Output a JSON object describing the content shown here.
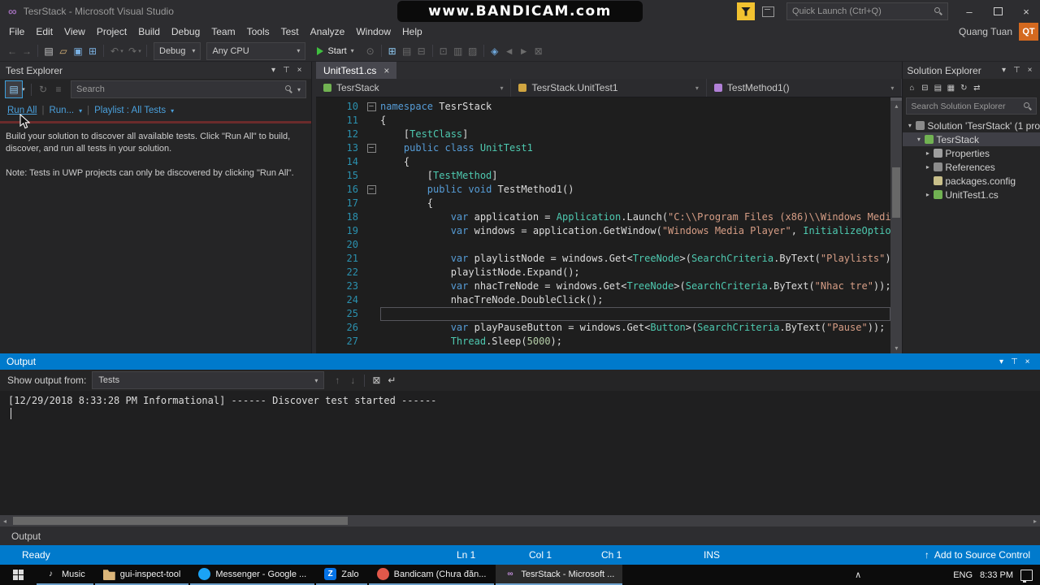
{
  "glyphs": {
    "chevron_down": "▾",
    "chevron_right": "▸",
    "triangle_up": "▴",
    "triangle_down": "▾",
    "triangle_left": "◂",
    "triangle_right": "▸",
    "close": "×",
    "pin": "⊤",
    "minimize": "–",
    "fold_collapse": "–",
    "infinity": "∞",
    "separator_bar": "|",
    "up_arrow": "↑"
  },
  "colors": {
    "accent_blue": "#007acc",
    "chrome_background": "#2d2d30",
    "panel_background": "#252526",
    "editor_background": "#1e1e1e",
    "keyword": "#569cd6",
    "type": "#4ec9b0",
    "string": "#d69d85",
    "number": "#b5cea8",
    "line_number": "#2b91af",
    "link_blue": "#4aa0dc",
    "bandicam_red": "#e23c32"
  },
  "window": {
    "title": "TesrStack - Microsoft Visual Studio",
    "watermark": "www.BANDICAM.com",
    "quick_launch_placeholder": "Quick Launch (Ctrl+Q)",
    "user_name": "Quang Tuan",
    "user_initials": "QT"
  },
  "menu": {
    "items": [
      "File",
      "Edit",
      "View",
      "Project",
      "Build",
      "Debug",
      "Team",
      "Tools",
      "Test",
      "Analyze",
      "Window",
      "Help"
    ]
  },
  "toolbar": {
    "config_value": "Debug",
    "platform_value": "Any CPU",
    "start_label": "Start",
    "icons_left": [
      {
        "name": "navigate-backward",
        "glyph": "←",
        "cls": "dim"
      },
      {
        "name": "navigate-forward",
        "glyph": "→",
        "cls": "dim"
      },
      {
        "name": "separator",
        "cls": "sep",
        "ni": true
      },
      {
        "name": "new-project",
        "glyph": "▤"
      },
      {
        "name": "open-file",
        "glyph": "▱",
        "color": "#dcb67a"
      },
      {
        "name": "save",
        "glyph": "▣",
        "color": "#7ab0e2"
      },
      {
        "name": "save-all",
        "glyph": "⊞",
        "color": "#7ab0e2"
      },
      {
        "name": "separator",
        "cls": "sep",
        "ni": true
      },
      {
        "name": "undo",
        "glyph": "↶",
        "cls": "dim"
      },
      {
        "name": "undo-dropdown",
        "glyph": "▾",
        "cls": "dim chev-sm"
      },
      {
        "name": "redo",
        "glyph": "↷",
        "cls": "dim"
      },
      {
        "name": "redo-dropdown",
        "glyph": "▾",
        "cls": "dim chev-sm"
      },
      {
        "name": "separator",
        "cls": "sep",
        "ni": true
      }
    ],
    "icons_right": [
      {
        "name": "hot-reload",
        "glyph": "⊙",
        "cls": "dim"
      },
      {
        "name": "separator",
        "cls": "sep",
        "ni": true
      },
      {
        "name": "solution-explorer-shortcut",
        "glyph": "⊞",
        "color": "#8fc9f2"
      },
      {
        "name": "properties-window",
        "glyph": "▤",
        "cls": "dim"
      },
      {
        "name": "toolbox",
        "glyph": "⊟",
        "cls": "dim"
      },
      {
        "name": "separator",
        "cls": "sep",
        "ni": true
      },
      {
        "name": "find-in-files",
        "glyph": "⊡",
        "cls": "dim"
      },
      {
        "name": "comment-out",
        "glyph": "▥",
        "cls": "dim"
      },
      {
        "name": "uncomment-lines",
        "glyph": "▨",
        "cls": "dim"
      },
      {
        "name": "separator",
        "cls": "sep",
        "ni": true
      },
      {
        "name": "toggle-bookmark",
        "glyph": "◈",
        "color": "#6fa8dc"
      },
      {
        "name": "prev-bookmark",
        "glyph": "◄",
        "cls": "dim"
      },
      {
        "name": "next-bookmark",
        "glyph": "►",
        "cls": "dim"
      },
      {
        "name": "clear-bookmarks",
        "glyph": "⊠",
        "cls": "dim"
      }
    ]
  },
  "test_explorer": {
    "title": "Test Explorer",
    "header_icons": [
      {
        "name": "window-menu",
        "glyph": "▾"
      },
      {
        "name": "pin",
        "glyph": "⊤"
      },
      {
        "name": "close",
        "glyph": "×"
      }
    ],
    "toolbar_icons": [
      {
        "name": "group-by",
        "glyph": "▤",
        "cls": "boxed"
      },
      {
        "name": "group-by-dropdown",
        "glyph": "▾",
        "cls": "chev-sm"
      },
      {
        "name": "separator",
        "cls": "sep",
        "ni": true
      },
      {
        "name": "run-after-build",
        "glyph": "↻",
        "cls": "dim"
      },
      {
        "name": "test-hierarchy",
        "glyph": "≡",
        "cls": "dim"
      }
    ],
    "search_placeholder": "Search",
    "run_all_label": "Run All",
    "run_label": "Run...",
    "playlist_label": "Playlist : All Tests",
    "message_primary": "Build your solution to discover all available tests. Click \"Run All\" to build, discover, and run all tests in your solution.",
    "message_note": "Note: Tests in UWP projects can only be discovered by clicking \"Run All\"."
  },
  "editor": {
    "tab_label": "UnitTest1.cs",
    "breadcrumb": {
      "project": "TesrStack",
      "type": "TesrStack.UnitTest1",
      "member": "TestMethod1()"
    },
    "lines": [
      {
        "num": 10,
        "fold": true,
        "tokens": [
          [
            "kw",
            "namespace"
          ],
          [
            "pl",
            " TesrStack"
          ]
        ]
      },
      {
        "num": 11,
        "tokens": [
          [
            "pl",
            "{"
          ]
        ]
      },
      {
        "num": 12,
        "tokens": [
          [
            "pl",
            "    ["
          ],
          [
            "ty",
            "TestClass"
          ],
          [
            "pl",
            "]"
          ]
        ]
      },
      {
        "num": 13,
        "fold": true,
        "tokens": [
          [
            "pl",
            "    "
          ],
          [
            "kw",
            "public"
          ],
          [
            "pl",
            " "
          ],
          [
            "kw",
            "class"
          ],
          [
            "pl",
            " "
          ],
          [
            "ty",
            "UnitTest1"
          ]
        ]
      },
      {
        "num": 14,
        "tokens": [
          [
            "pl",
            "    {"
          ]
        ]
      },
      {
        "num": 15,
        "tokens": [
          [
            "pl",
            "        ["
          ],
          [
            "ty",
            "TestMethod"
          ],
          [
            "pl",
            "]"
          ]
        ]
      },
      {
        "num": 16,
        "fold": true,
        "tokens": [
          [
            "pl",
            "        "
          ],
          [
            "kw",
            "public"
          ],
          [
            "pl",
            " "
          ],
          [
            "kw",
            "void"
          ],
          [
            "pl",
            " TestMethod1()"
          ]
        ]
      },
      {
        "num": 17,
        "tokens": [
          [
            "pl",
            "        {"
          ]
        ]
      },
      {
        "num": 18,
        "tokens": [
          [
            "pl",
            "            "
          ],
          [
            "kw",
            "var"
          ],
          [
            "pl",
            " application = "
          ],
          [
            "ty",
            "Application"
          ],
          [
            "pl",
            ".Launch("
          ],
          [
            "st",
            "\"C:\\\\Program Files (x86)\\\\Windows Medi"
          ]
        ]
      },
      {
        "num": 19,
        "tokens": [
          [
            "pl",
            "            "
          ],
          [
            "kw",
            "var"
          ],
          [
            "pl",
            " windows = application.GetWindow("
          ],
          [
            "st",
            "\"Windows Media Player\""
          ],
          [
            "pl",
            ", "
          ],
          [
            "ty",
            "InitializeOptio"
          ]
        ]
      },
      {
        "num": 20,
        "tokens": []
      },
      {
        "num": 21,
        "tokens": [
          [
            "pl",
            "            "
          ],
          [
            "kw",
            "var"
          ],
          [
            "pl",
            " playlistNode = windows.Get<"
          ],
          [
            "ty",
            "TreeNode"
          ],
          [
            "pl",
            ">("
          ],
          [
            "ty",
            "SearchCriteria"
          ],
          [
            "pl",
            ".ByText("
          ],
          [
            "st",
            "\"Playlists\""
          ],
          [
            "pl",
            ")"
          ]
        ]
      },
      {
        "num": 22,
        "tokens": [
          [
            "pl",
            "            playlistNode.Expand();"
          ]
        ]
      },
      {
        "num": 23,
        "tokens": [
          [
            "pl",
            "            "
          ],
          [
            "kw",
            "var"
          ],
          [
            "pl",
            " nhacTreNode = windows.Get<"
          ],
          [
            "ty",
            "TreeNode"
          ],
          [
            "pl",
            ">("
          ],
          [
            "ty",
            "SearchCriteria"
          ],
          [
            "pl",
            ".ByText("
          ],
          [
            "st",
            "\"Nhac tre\""
          ],
          [
            "pl",
            "));"
          ]
        ]
      },
      {
        "num": 24,
        "tokens": [
          [
            "pl",
            "            nhacTreNode.DoubleClick();"
          ]
        ]
      },
      {
        "num": 25,
        "current": true,
        "tokens": []
      },
      {
        "num": 26,
        "tokens": [
          [
            "pl",
            "            "
          ],
          [
            "kw",
            "var"
          ],
          [
            "pl",
            " playPauseButton = windows.Get<"
          ],
          [
            "ty",
            "Button"
          ],
          [
            "pl",
            ">("
          ],
          [
            "ty",
            "SearchCriteria"
          ],
          [
            "pl",
            ".ByText("
          ],
          [
            "st",
            "\"Pause\""
          ],
          [
            "pl",
            "));"
          ]
        ]
      },
      {
        "num": 27,
        "tokens": [
          [
            "pl",
            "            "
          ],
          [
            "ty",
            "Thread"
          ],
          [
            "pl",
            ".Sleep("
          ],
          [
            "nu",
            "5000"
          ],
          [
            "pl",
            ");"
          ]
        ]
      }
    ]
  },
  "solution_explorer": {
    "title": "Solution Explorer",
    "search_placeholder": "Search Solution Explorer",
    "header_icons": [
      {
        "name": "window-menu",
        "glyph": "▾"
      },
      {
        "name": "pin",
        "glyph": "⊤"
      },
      {
        "name": "close",
        "glyph": "×"
      }
    ],
    "toolbar_icons": [
      {
        "name": "home",
        "glyph": "⌂"
      },
      {
        "name": "collapse-all",
        "glyph": "⊟"
      },
      {
        "name": "properties",
        "glyph": "▤"
      },
      {
        "name": "show-all-files",
        "glyph": "▦"
      },
      {
        "name": "refresh",
        "glyph": "↻"
      },
      {
        "name": "sync-with-active-document",
        "glyph": "⇄"
      }
    ],
    "tree": [
      {
        "label": "Solution 'TesrStack' (1 pro",
        "indent": 0,
        "arrow": "down",
        "icon": "solution",
        "selected": false
      },
      {
        "label": "TesrStack",
        "indent": 1,
        "arrow": "down",
        "icon": "csproj",
        "selected": true
      },
      {
        "label": "Properties",
        "indent": 2,
        "arrow": "right",
        "icon": "properties",
        "selected": false
      },
      {
        "label": "References",
        "indent": 2,
        "arrow": "right",
        "icon": "references",
        "selected": false
      },
      {
        "label": "packages.config",
        "indent": 2,
        "arrow": "none",
        "icon": "config",
        "selected": false
      },
      {
        "label": "UnitTest1.cs",
        "indent": 2,
        "arrow": "right",
        "icon": "csfile",
        "selected": false
      }
    ]
  },
  "output": {
    "title": "Output",
    "header_icons": [
      {
        "name": "window-menu",
        "glyph": "▾",
        "cls": "wh"
      },
      {
        "name": "pin",
        "glyph": "⊤",
        "cls": "wh"
      },
      {
        "name": "close",
        "glyph": "×",
        "cls": "wh"
      }
    ],
    "show_output_from_label": "Show output from:",
    "source_value": "Tests",
    "toolbar_icons": [
      {
        "name": "prev-message",
        "glyph": "↑",
        "cls": "dim"
      },
      {
        "name": "next-message",
        "glyph": "↓",
        "cls": "dim"
      },
      {
        "name": "separator",
        "cls": "sep",
        "ni": true
      },
      {
        "name": "clear-all",
        "glyph": "⊠"
      },
      {
        "name": "toggle-word-wrap",
        "glyph": "↵"
      }
    ],
    "log_line": "[12/29/2018 8:33:28 PM Informational] ------ Discover test started ------",
    "bottom_tab_label": "Output"
  },
  "status_bar": {
    "state": "Ready",
    "line": "Ln 1",
    "column": "Col 1",
    "character": "Ch 1",
    "mode": "INS",
    "source_control": "Add to Source Control"
  },
  "taskbar": {
    "apps": [
      {
        "label": "Music",
        "icon": "music-note",
        "glyph": "♪",
        "fg": "#e8e8e8",
        "bg": "transparent"
      },
      {
        "label": "gui-inspect-tool",
        "icon": "folder",
        "bg": "#dcb67a"
      },
      {
        "label": "Messenger - Google ...",
        "icon": "messenger",
        "bg": "#1ba3f5",
        "shape": "circle"
      },
      {
        "label": "Zalo",
        "icon": "zalo",
        "bg": "#0573e7",
        "glyph": "Z",
        "fg": "#ffffff"
      },
      {
        "label": "Bandicam (Chưa đăn...",
        "icon": "bandicam",
        "bg": "#e2584a",
        "shape": "circle"
      },
      {
        "label": "TesrStack - Microsoft ...",
        "icon": "visual-studio",
        "glyph": "∞",
        "fg": "#c48fdd",
        "bg": "transparent",
        "active": true
      }
    ],
    "tray_icons": [
      {
        "name": "hidden-icons",
        "glyph": "∧"
      },
      {
        "name": "recording-indicator",
        "cls": "dot-red"
      },
      {
        "name": "volume",
        "cls": "speaker"
      },
      {
        "name": "red-app-badge",
        "cls": "badge badge-red"
      },
      {
        "name": "blue-app-badge",
        "cls": "badge badge-blue"
      },
      {
        "name": "network",
        "cls": "net"
      }
    ],
    "language": "ENG",
    "time": "8:33 PM"
  }
}
